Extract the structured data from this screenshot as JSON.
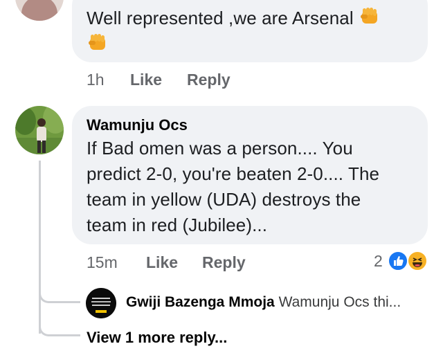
{
  "comments": [
    {
      "text": "Well represented ,we are Arsenal",
      "time": "1h",
      "like_label": "Like",
      "reply_label": "Reply"
    },
    {
      "author": "Wamunju Ocs",
      "text_lines": [
        "If Bad omen was a person.... You",
        "predict 2-0, you're beaten 2-0.... The",
        "team in yellow (UDA) destroys the",
        "team in red (Jubilee)..."
      ],
      "time": "15m",
      "like_label": "Like",
      "reply_label": "Reply",
      "reaction_count": "2",
      "reactions": [
        "like-icon",
        "haha-icon"
      ]
    }
  ],
  "reply_preview": {
    "author": "Gwiji Bazenga Mmoja",
    "snippet": "Wamunju Ocs thi..."
  },
  "more_replies_label": "View 1 more reply...",
  "colors": {
    "bubble": "#f0f2f5",
    "meta": "#65676b",
    "like_blue": "#1877f2",
    "haha_yellow": "#f7b125"
  }
}
